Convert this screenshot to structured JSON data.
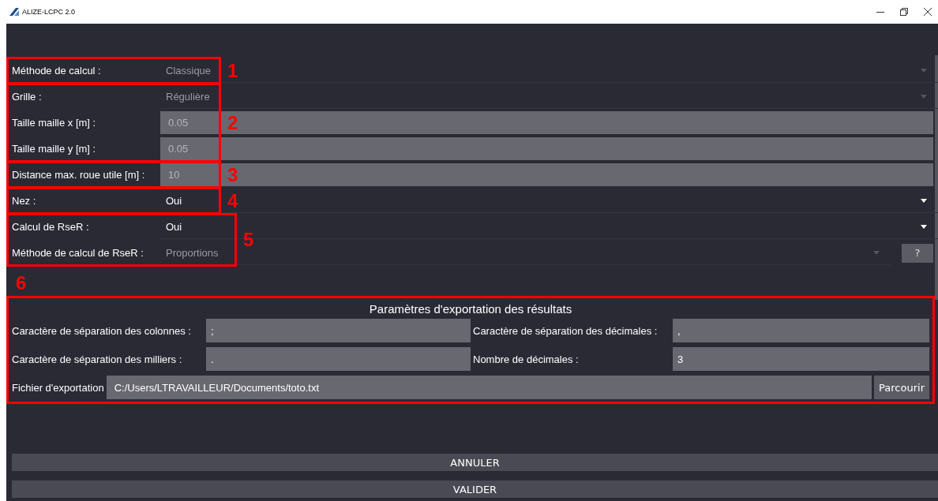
{
  "window": {
    "title": "ALIZE-LCPC 2.0"
  },
  "groups": [
    {
      "number": "1",
      "rows": [
        {
          "kind": "combo",
          "label": "Méthode de calcul :",
          "value": "Classique",
          "disabled": true
        }
      ]
    },
    {
      "number": "2",
      "rows": [
        {
          "kind": "combo",
          "label": "Grille :",
          "value": "Régulière",
          "disabled": true
        },
        {
          "kind": "field",
          "label": "Taille maille x [m] :",
          "value": "0.05",
          "disabled": true
        },
        {
          "kind": "field",
          "label": "Taille maille y [m] :",
          "value": "0.05",
          "disabled": true
        }
      ]
    },
    {
      "number": "3",
      "rows": [
        {
          "kind": "field",
          "label": "Distance max. roue utile [m] :",
          "value": "10",
          "disabled": true
        }
      ]
    },
    {
      "number": "4",
      "rows": [
        {
          "kind": "combo",
          "label": "Nez :",
          "value": "Oui",
          "disabled": false
        }
      ]
    },
    {
      "number": "5",
      "rows": [
        {
          "kind": "combo",
          "label": "Calcul de RseR :",
          "value": "Oui",
          "disabled": false
        },
        {
          "kind": "combo",
          "label": "Méthode de calcul de RseR :",
          "value": "Proportions",
          "disabled": true,
          "help": "?"
        }
      ]
    }
  ],
  "export": {
    "number": "6",
    "title": "Paramètres d'exportation des résultats",
    "fields": [
      {
        "label": "Caractère de séparation des colonnes :",
        "value": ";"
      },
      {
        "label": "Caractère de séparation des décimales :",
        "value": ","
      },
      {
        "label": "Caractère de séparation des milliers :",
        "value": "."
      },
      {
        "label": "Nombre de décimales :",
        "value": "3"
      }
    ],
    "file": {
      "label": "Fichier d'exportation",
      "value": "C:/Users/LTRAVAILLEUR/Documents/toto.txt",
      "button": "Parcourir"
    }
  },
  "buttons": [
    "ANNULER",
    "VALIDER"
  ]
}
